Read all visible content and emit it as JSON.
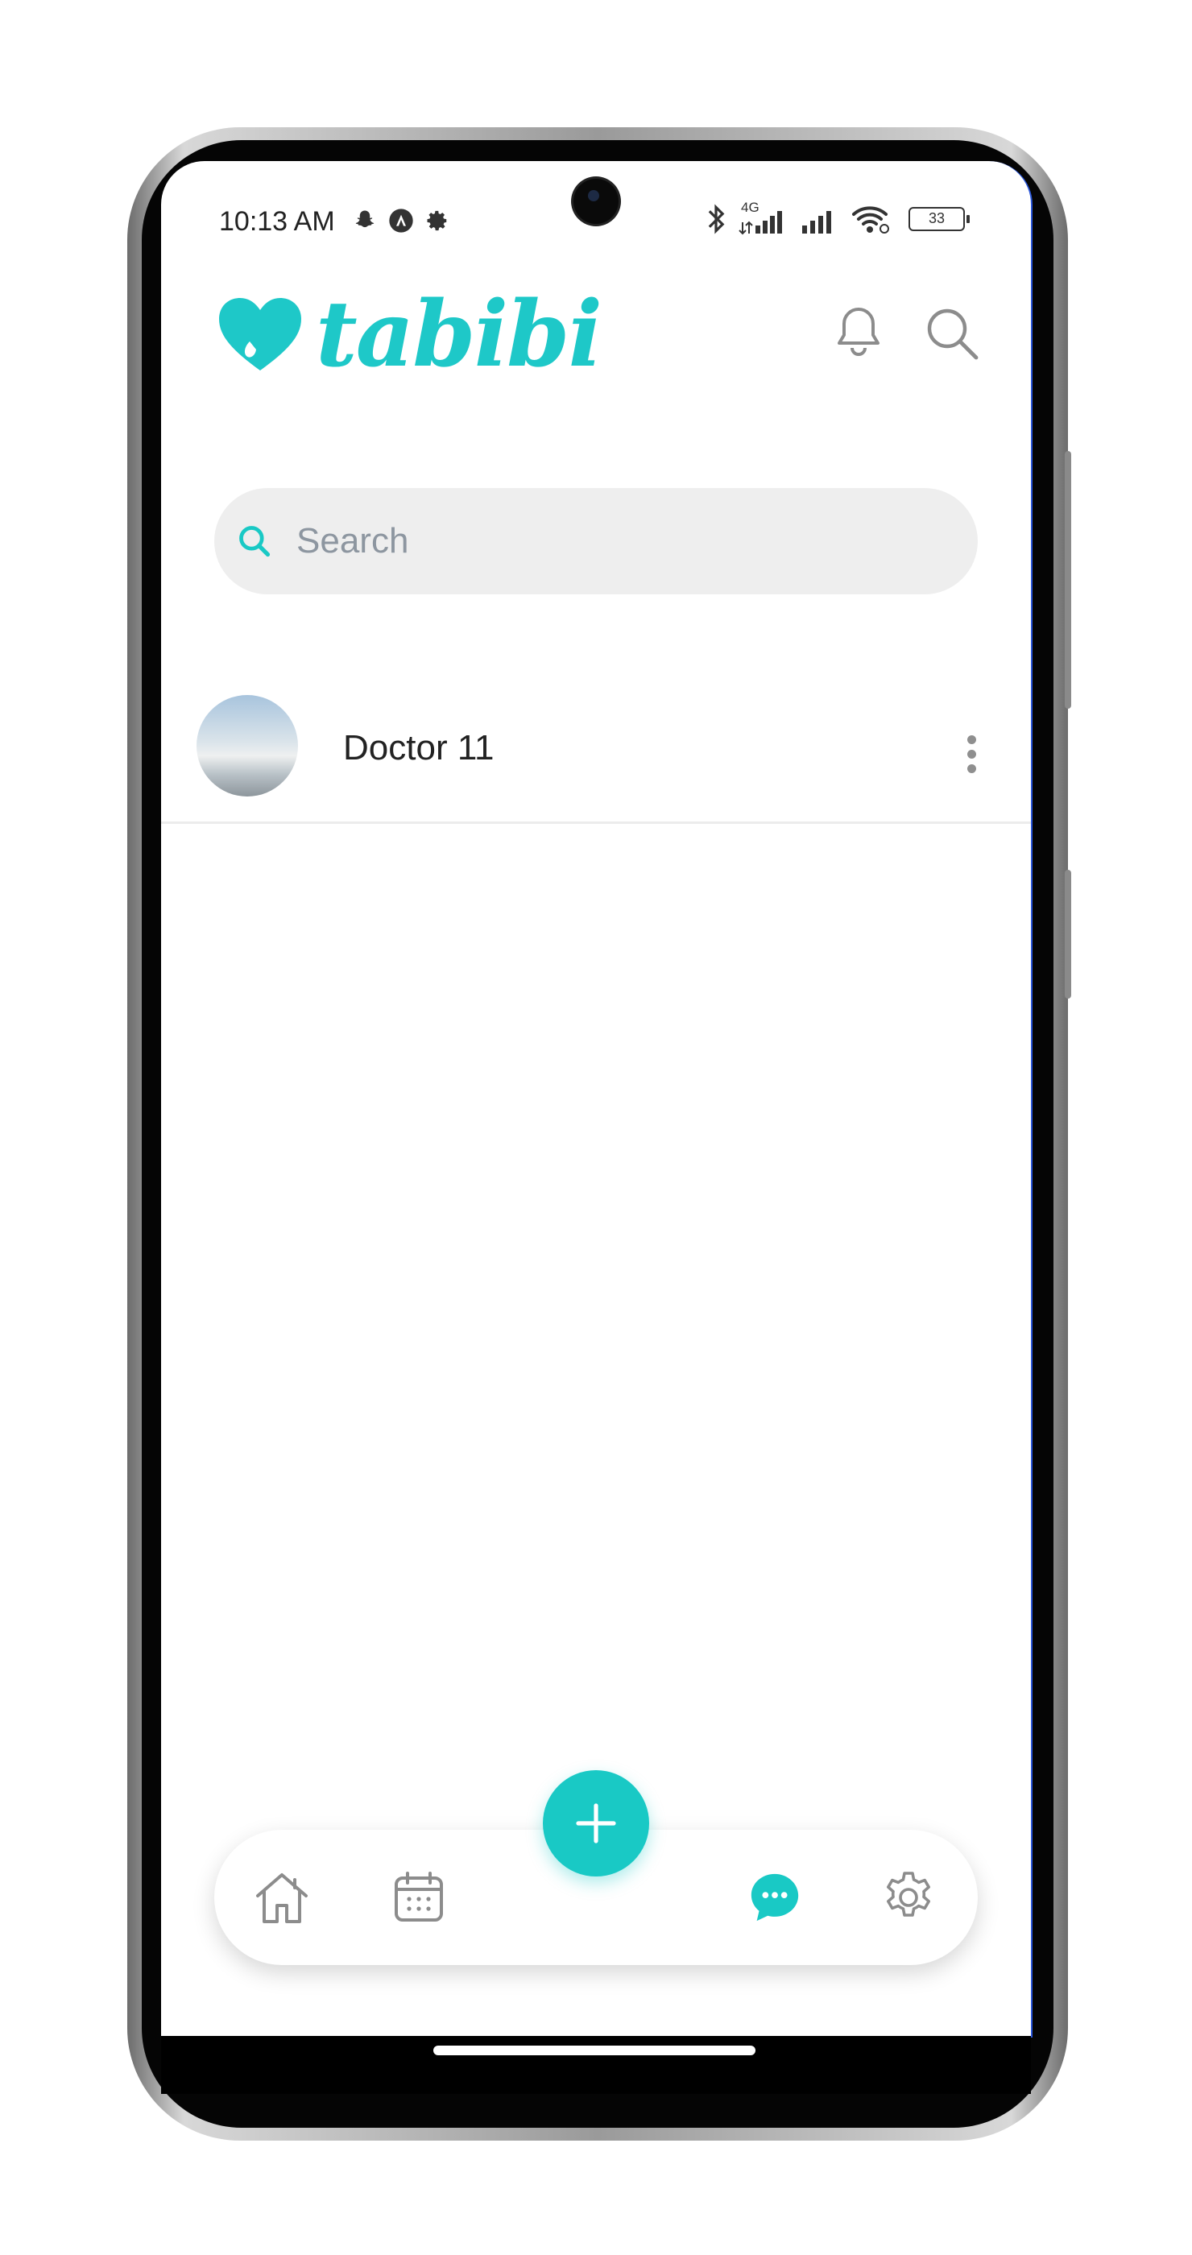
{
  "status_bar": {
    "time": "10:13 AM",
    "network": "4G",
    "battery": "33"
  },
  "header": {
    "app_name": "tabibi"
  },
  "search": {
    "placeholder": "Search",
    "value": ""
  },
  "chats": [
    {
      "name": "Doctor 11"
    }
  ],
  "bottom_nav": {
    "items": [
      {
        "id": "home",
        "icon": "home-icon",
        "active": false
      },
      {
        "id": "calendar",
        "icon": "calendar-icon",
        "active": false
      },
      {
        "id": "chat",
        "icon": "chat-icon",
        "active": true
      },
      {
        "id": "settings",
        "icon": "gear-icon",
        "active": false
      }
    ],
    "fab_icon": "plus-icon"
  },
  "colors": {
    "accent": "#19c9c5",
    "icon_gray": "#8c8c8c",
    "search_bg": "#eeeeee"
  }
}
